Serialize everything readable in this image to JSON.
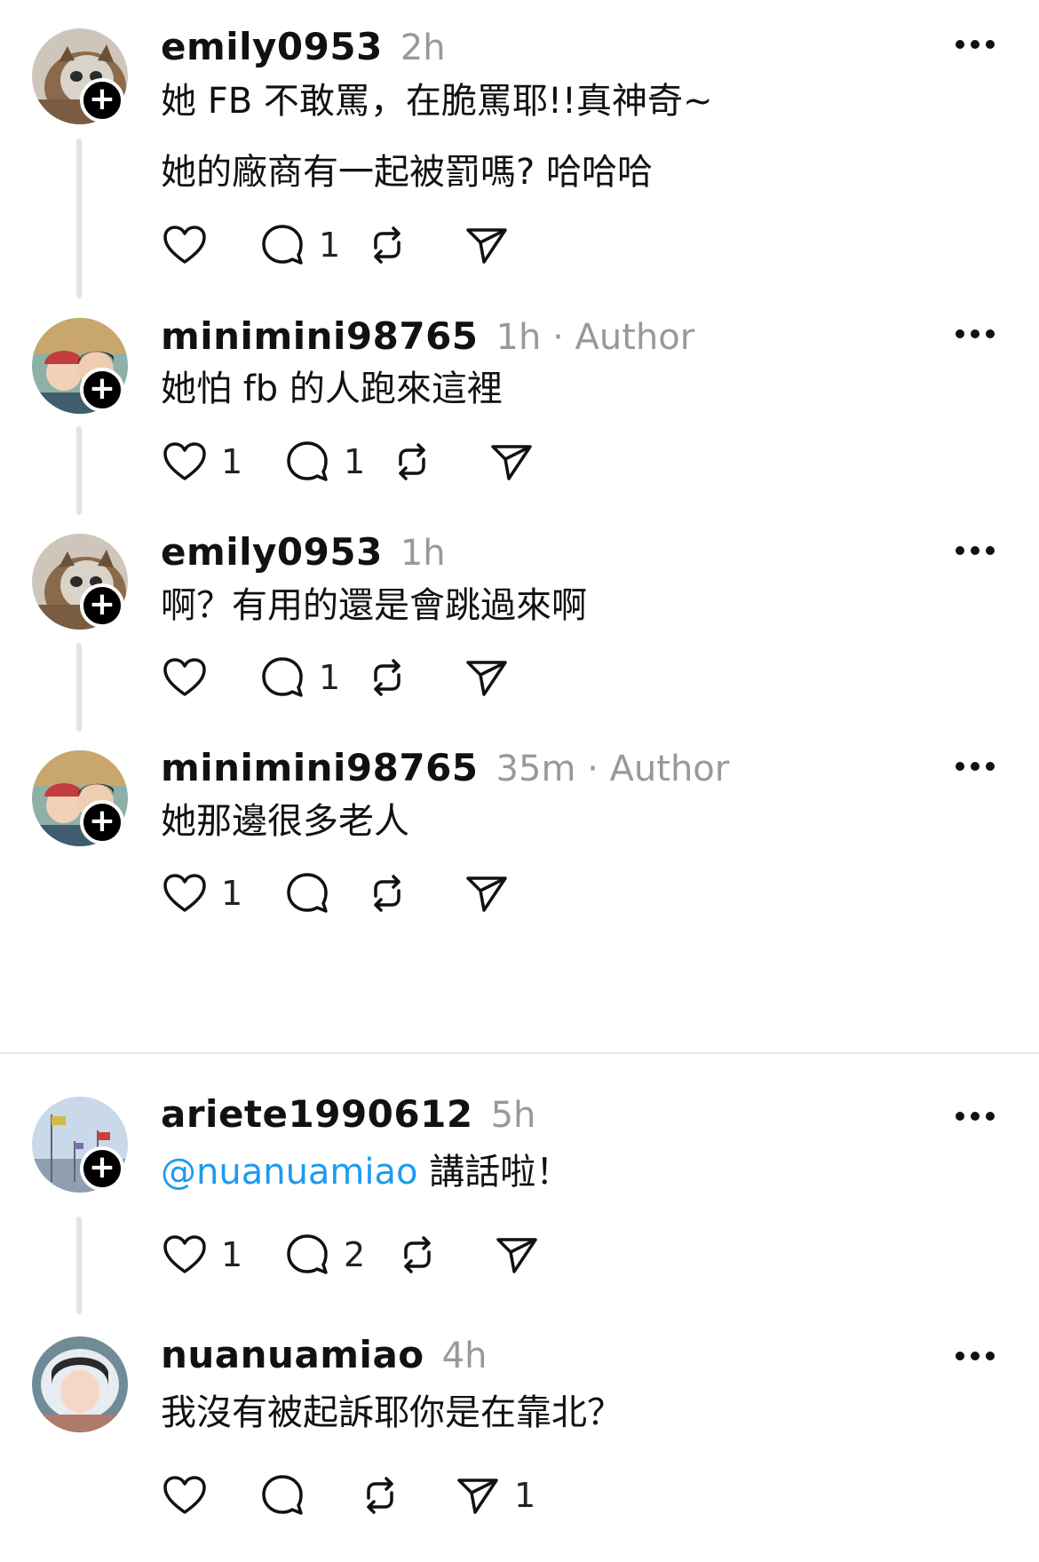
{
  "comments": [
    {
      "username": "emily0953",
      "meta": "2h",
      "lines": [
        "她 FB 不敢罵，在脆罵耶!!真神奇~",
        "她的廠商有一起被罰嗎? 哈哈哈"
      ],
      "likes": "",
      "replies": "1",
      "shares": "",
      "avatar": "cat-avatar"
    },
    {
      "username": "minimini98765",
      "meta": "1h · Author",
      "lines": [
        "她怕 fb 的人跑來這裡"
      ],
      "likes": "1",
      "replies": "1",
      "shares": "",
      "avatar": "couple-avatar"
    },
    {
      "username": "emily0953",
      "meta": "1h",
      "lines": [
        "啊？有用的還是會跳過來啊"
      ],
      "likes": "",
      "replies": "1",
      "shares": "",
      "avatar": "cat-avatar"
    },
    {
      "username": "minimini98765",
      "meta": "35m · Author",
      "lines": [
        "她那邊很多老人"
      ],
      "likes": "1",
      "replies": "",
      "shares": "",
      "avatar": "couple-avatar"
    },
    {
      "username": "ariete1990612",
      "meta": "5h",
      "mention": "@nuanuamiao",
      "lines": [
        " 講話啦！"
      ],
      "likes": "1",
      "replies": "2",
      "shares": "",
      "avatar": "flags-avatar"
    },
    {
      "username": "nuanuamiao",
      "meta": "4h",
      "lines": [
        "我沒有被起訴耶你是在靠北？"
      ],
      "likes": "",
      "replies": "",
      "shares": "1",
      "avatar": "girl-avatar"
    }
  ],
  "colors": {
    "text": "#111111",
    "meta": "#999999",
    "mention": "#1d9bf0",
    "thread_line": "#e3e3e3"
  }
}
